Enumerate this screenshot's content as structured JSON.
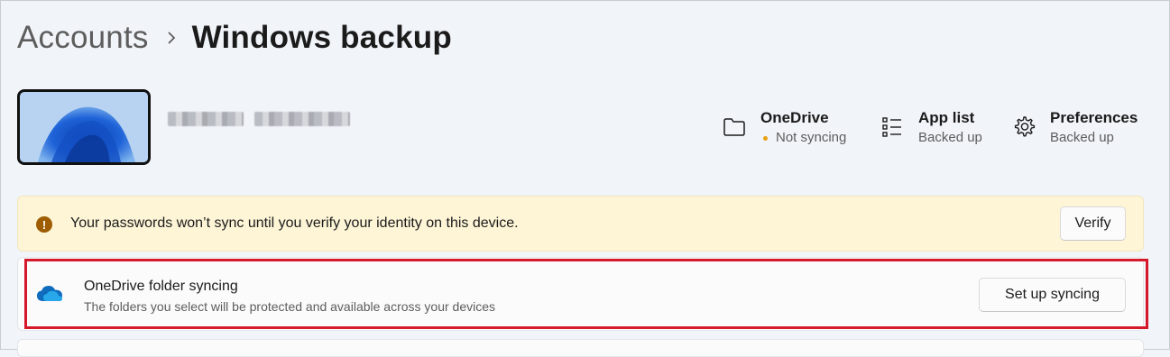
{
  "breadcrumb": {
    "parent": "Accounts",
    "current": "Windows backup"
  },
  "status": {
    "onedrive": {
      "title": "OneDrive",
      "sub": "Not syncing",
      "icon": "folder-icon",
      "dot_color": "#e8a010"
    },
    "app_list": {
      "title": "App list",
      "sub": "Backed up",
      "icon": "list-icon"
    },
    "preferences": {
      "title": "Preferences",
      "sub": "Backed up",
      "icon": "gear-icon"
    }
  },
  "warning": {
    "icon": "warning-icon",
    "icon_glyph": "!",
    "text": "Your passwords won’t sync until you verify your identity on this device.",
    "button": "Verify"
  },
  "onedrive_card": {
    "icon": "onedrive-cloud-icon",
    "title": "OneDrive folder syncing",
    "subtitle": "The folders you select will be protected and available across your devices",
    "button": "Set up syncing"
  },
  "colors": {
    "highlight": "#d6182b",
    "warning_bg": "#fdf5d6",
    "onedrive_blue": "#0f6cbd"
  }
}
